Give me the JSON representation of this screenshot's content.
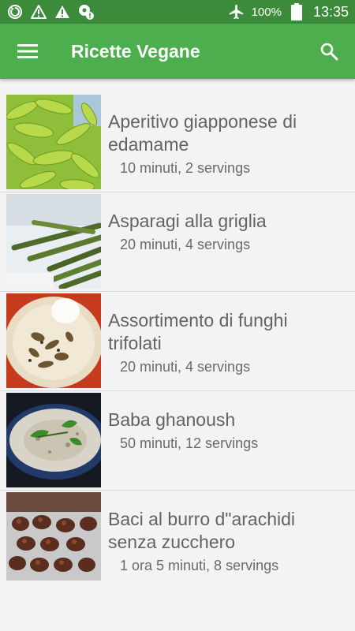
{
  "status_bar": {
    "battery_percent": "100%",
    "time": "13:35",
    "icons": [
      "sync-icon",
      "warning-icon",
      "warning-filled-icon",
      "location-alert-icon",
      "airplane-icon",
      "battery-icon"
    ]
  },
  "app_bar": {
    "title": "Ricette Vegane",
    "color": "#4cae4c",
    "status_color": "#3c8b3b"
  },
  "recipes": [
    {
      "title": "Aperitivo giapponese di edamame",
      "meta": "10 minuti, 2 servings"
    },
    {
      "title": "Asparagi alla griglia",
      "meta": "20 minuti, 4 servings"
    },
    {
      "title": "Assortimento di funghi trifolati",
      "meta": "20 minuti, 4 servings"
    },
    {
      "title": "Baba ghanoush",
      "meta": "50 minuti, 12 servings"
    },
    {
      "title": "Baci al burro d\"arachidi senza zucchero",
      "meta": "1 ora 5 minuti, 8 servings"
    }
  ]
}
